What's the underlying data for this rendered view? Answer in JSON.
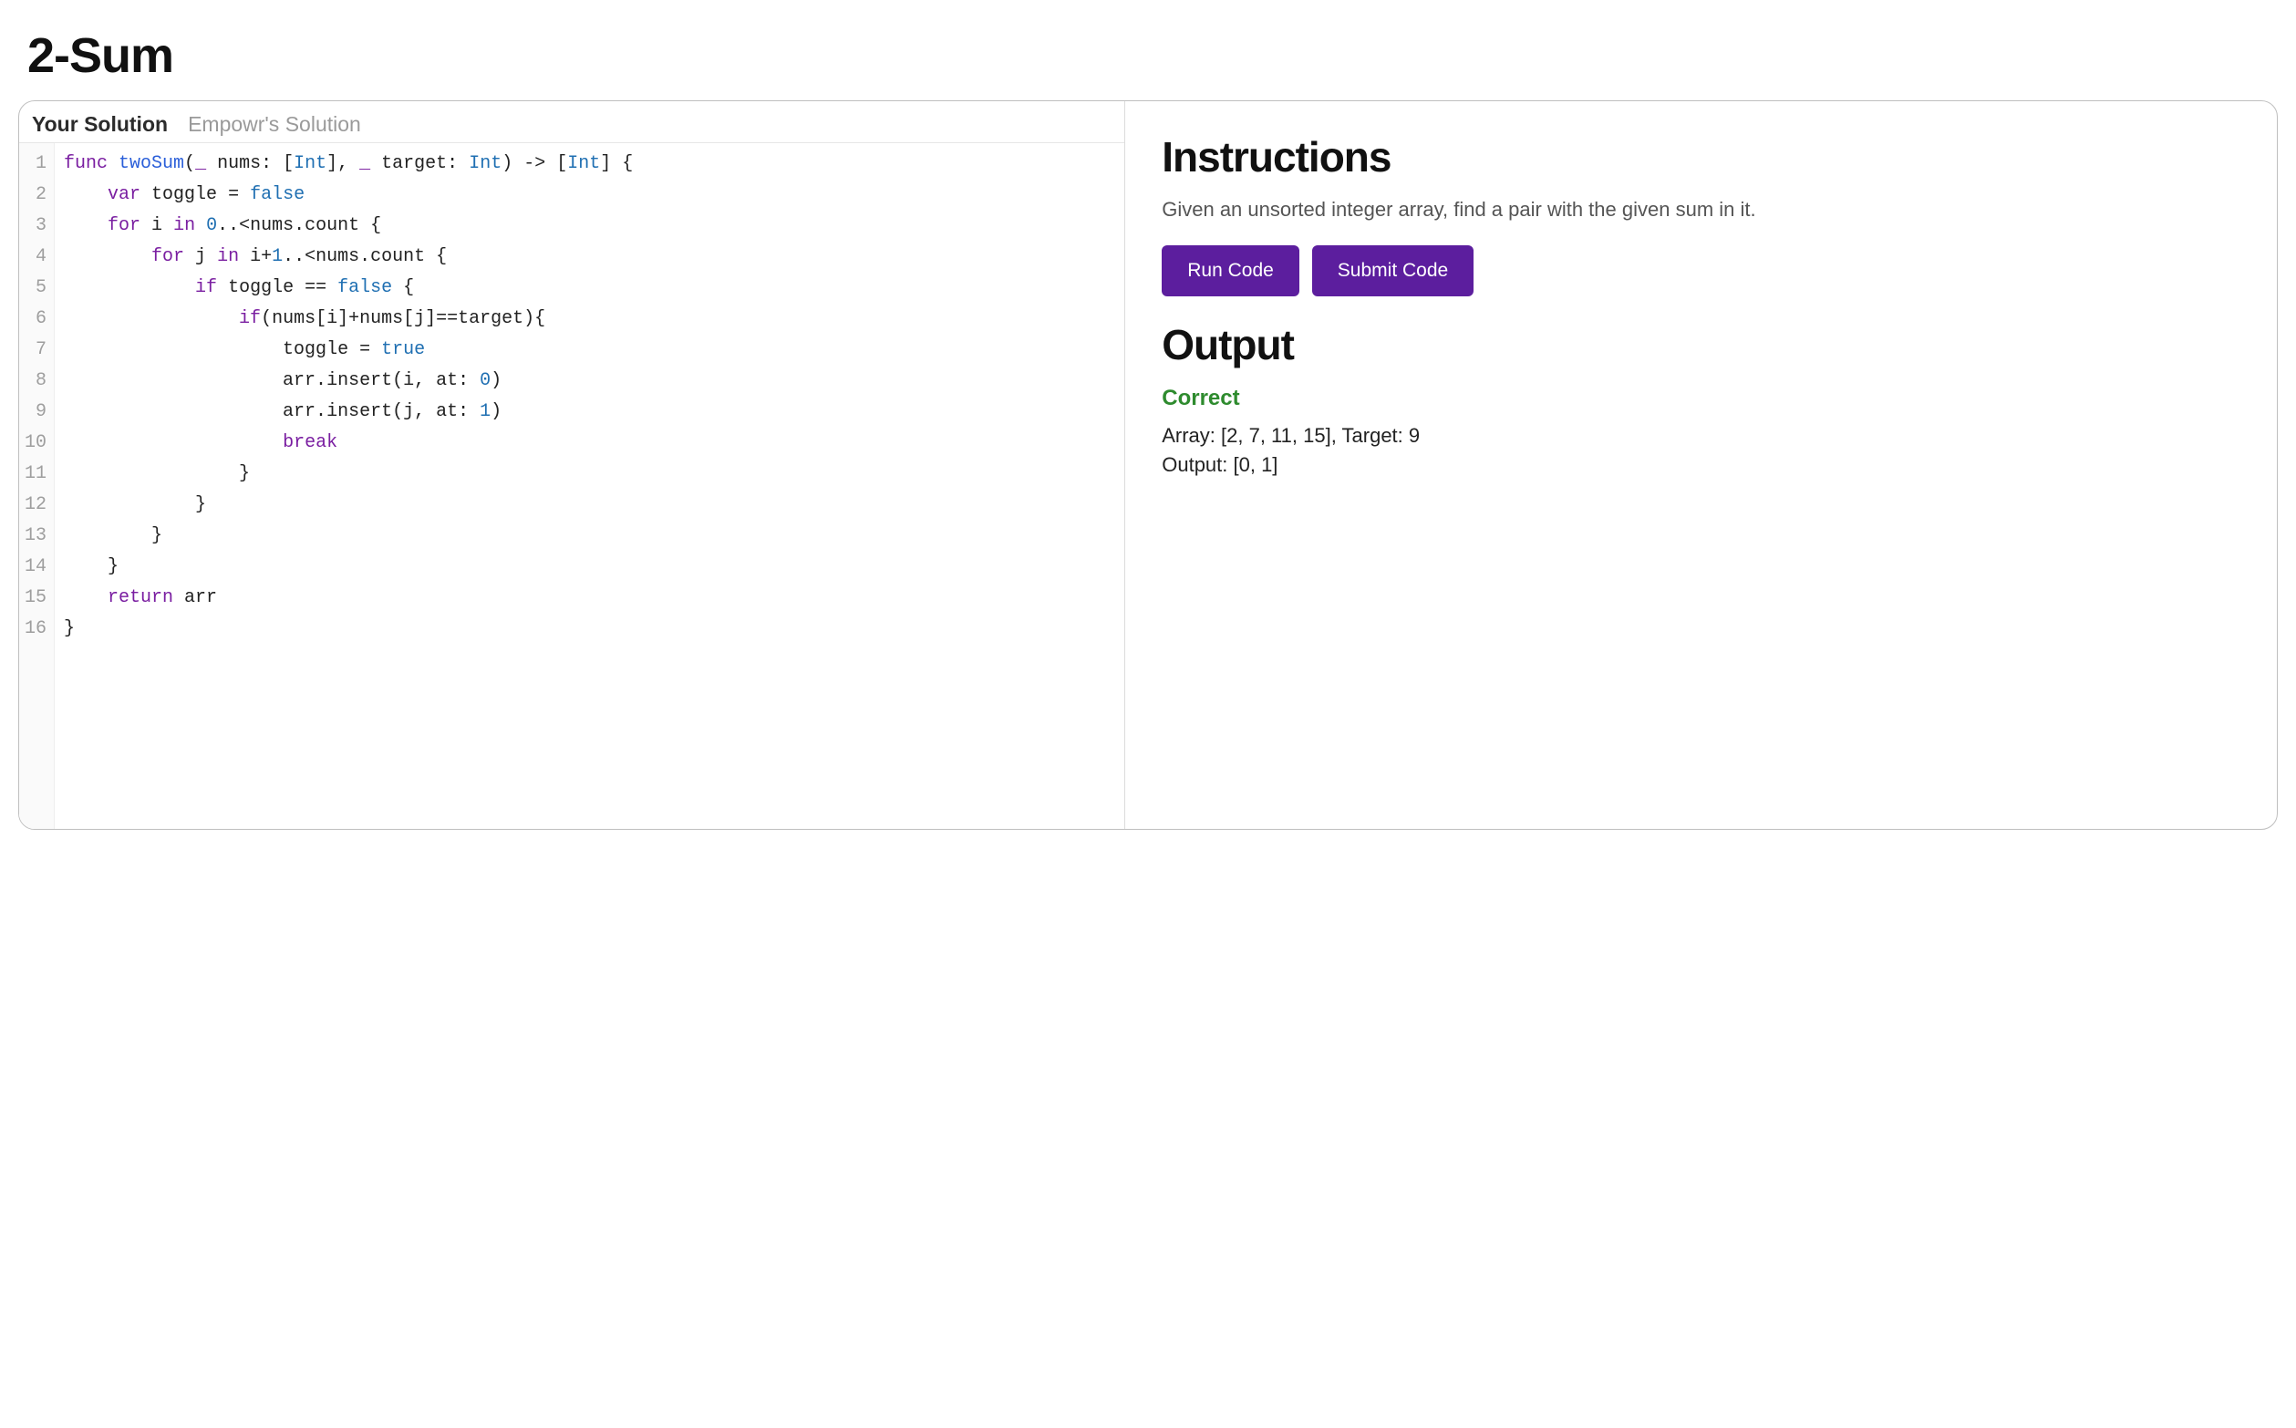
{
  "title": "2-Sum",
  "tabs": {
    "active": "Your Solution",
    "inactive": "Empowr's Solution"
  },
  "code_lines": [
    [
      {
        "t": "func ",
        "c": "tok-kw"
      },
      {
        "t": "twoSum",
        "c": "tok-fn"
      },
      {
        "t": "("
      },
      {
        "t": "_",
        "c": "tok-kw"
      },
      {
        "t": " nums"
      },
      {
        "t": ": ["
      },
      {
        "t": "Int",
        "c": "tok-type"
      },
      {
        "t": "], "
      },
      {
        "t": "_",
        "c": "tok-kw"
      },
      {
        "t": " target"
      },
      {
        "t": ": "
      },
      {
        "t": "Int",
        "c": "tok-type"
      },
      {
        "t": ") -> ["
      },
      {
        "t": "Int",
        "c": "tok-type"
      },
      {
        "t": "] {"
      }
    ],
    [
      {
        "t": "    "
      },
      {
        "t": "var ",
        "c": "tok-kw"
      },
      {
        "t": "toggle"
      },
      {
        "t": " = "
      },
      {
        "t": "false",
        "c": "tok-bool"
      }
    ],
    [
      {
        "t": "    "
      },
      {
        "t": "for ",
        "c": "tok-kw"
      },
      {
        "t": "i"
      },
      {
        "t": " "
      },
      {
        "t": "in ",
        "c": "tok-kw"
      },
      {
        "t": "0",
        "c": "tok-num"
      },
      {
        "t": "..<nums.count {"
      }
    ],
    [
      {
        "t": "        "
      },
      {
        "t": "for ",
        "c": "tok-kw"
      },
      {
        "t": "j"
      },
      {
        "t": " "
      },
      {
        "t": "in ",
        "c": "tok-kw"
      },
      {
        "t": "i+"
      },
      {
        "t": "1",
        "c": "tok-num"
      },
      {
        "t": "..<nums.count {"
      }
    ],
    [
      {
        "t": "            "
      },
      {
        "t": "if ",
        "c": "tok-kw"
      },
      {
        "t": "toggle == "
      },
      {
        "t": "false",
        "c": "tok-bool"
      },
      {
        "t": " {"
      }
    ],
    [
      {
        "t": "                "
      },
      {
        "t": "if",
        "c": "tok-kw"
      },
      {
        "t": "(nums[i]+nums[j]==target){"
      }
    ],
    [
      {
        "t": "                    toggle = "
      },
      {
        "t": "true",
        "c": "tok-bool"
      }
    ],
    [
      {
        "t": "                    arr.insert(i, at: "
      },
      {
        "t": "0",
        "c": "tok-num"
      },
      {
        "t": ")"
      }
    ],
    [
      {
        "t": "                    arr.insert(j, at: "
      },
      {
        "t": "1",
        "c": "tok-num"
      },
      {
        "t": ")"
      }
    ],
    [
      {
        "t": "                    "
      },
      {
        "t": "break",
        "c": "tok-kw"
      }
    ],
    [
      {
        "t": "                }"
      }
    ],
    [
      {
        "t": "            }"
      }
    ],
    [
      {
        "t": "        }"
      }
    ],
    [
      {
        "t": "    }"
      }
    ],
    [
      {
        "t": "    "
      },
      {
        "t": "return ",
        "c": "tok-kw"
      },
      {
        "t": "arr"
      }
    ],
    [
      {
        "t": "}"
      }
    ]
  ],
  "instructions": {
    "heading": "Instructions",
    "text": "Given an unsorted integer array, find a pair with the given sum in it."
  },
  "buttons": {
    "run": "Run Code",
    "submit": "Submit Code"
  },
  "output": {
    "heading": "Output",
    "status": "Correct",
    "lines": [
      "Array: [2, 7, 11, 15], Target: 9",
      "Output: [0, 1]"
    ]
  }
}
